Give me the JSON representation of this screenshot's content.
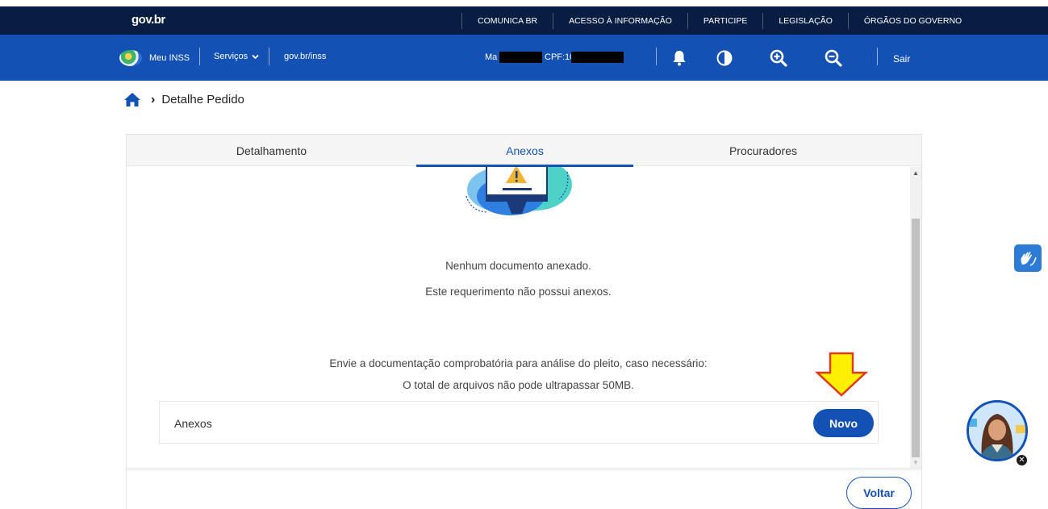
{
  "topbar": {
    "logo": "gov.br",
    "links": [
      "COMUNICA BR",
      "ACESSO À INFORMAÇÃO",
      "PARTICIPE",
      "LEGISLAÇÃO",
      "ÓRGÃOS DO GOVERNO"
    ]
  },
  "header": {
    "brand": "Meu INSS",
    "services": "Serviços",
    "services_icon": "chevron-down-icon",
    "site": "gov.br/inss",
    "user_name_prefix": "Ma",
    "user_cpf_prefix": "CPF:10",
    "icons": [
      "bell-icon",
      "contrast-icon",
      "zoom-in-icon",
      "zoom-out-icon"
    ],
    "logout": "Sair"
  },
  "breadcrumb": {
    "home_icon": "home-icon",
    "current": "Detalhe Pedido"
  },
  "tabs": {
    "items": [
      "Detalhamento",
      "Anexos",
      "Procuradores"
    ],
    "active_index": 1
  },
  "content": {
    "empty_title": "Nenhum documento anexado.",
    "empty_subtitle": "Este requerimento não possui anexos.",
    "instructions": "Envie a documentação comprobatória para análise do pleito, caso necessário:",
    "size_limit": "O total de arquivos não pode ultrapassar 50MB.",
    "anexos_label": "Anexos",
    "new_button": "Novo"
  },
  "footer": {
    "back_button": "Voltar"
  },
  "colors": {
    "topbar": "#071d41",
    "header": "#1351b4",
    "accent": "#1351b4",
    "arrow": "#ffef00"
  }
}
